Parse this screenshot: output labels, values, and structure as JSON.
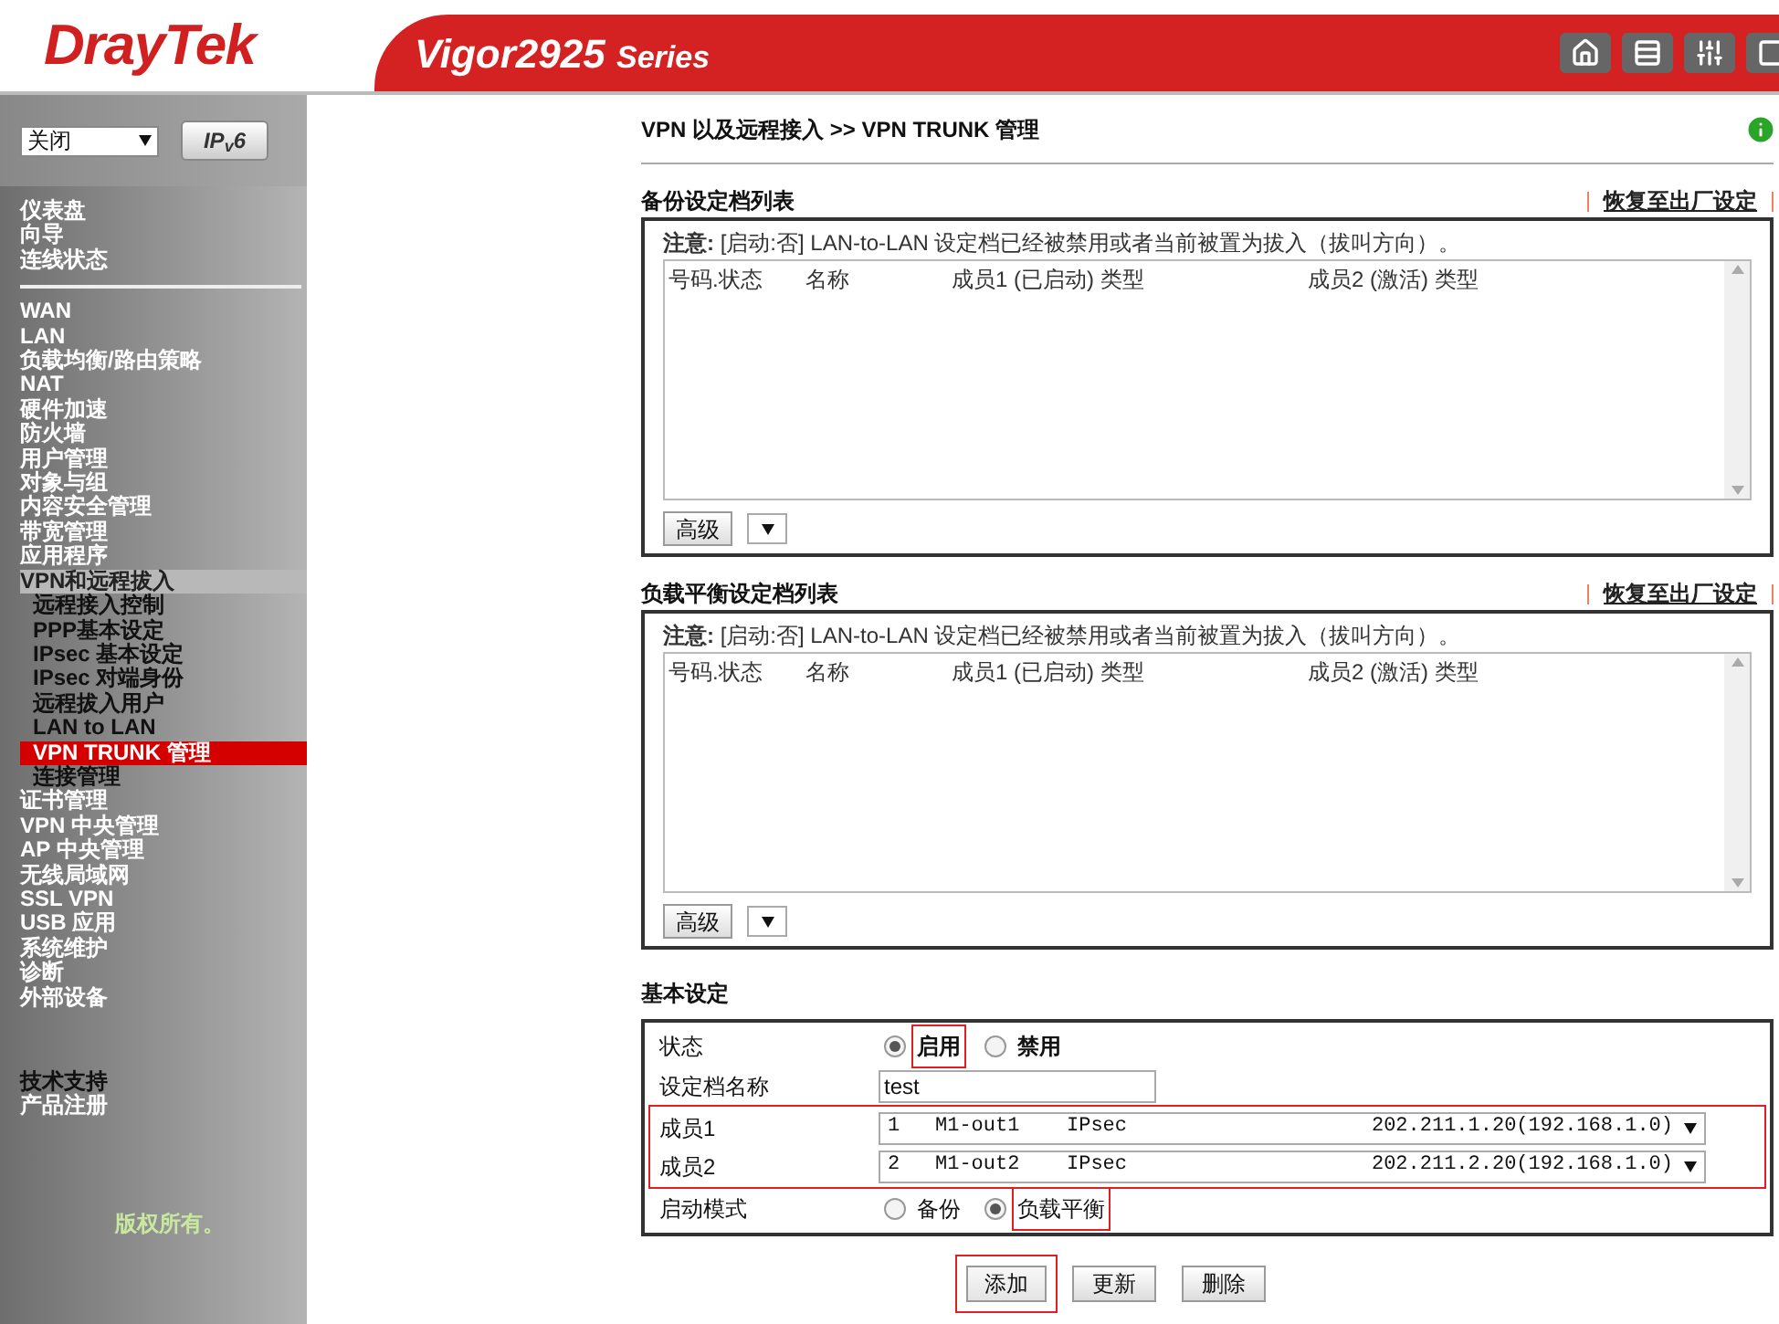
{
  "header": {
    "brand": "DrayTek",
    "model": "Vigor2925",
    "series": "Series"
  },
  "sidebar": {
    "mode_select": "关闭",
    "ipv6_button": "IP$_{v}$6",
    "groups": [
      [
        {
          "label": "仪表盘",
          "selected": false
        },
        {
          "label": "向导",
          "selected": false
        },
        {
          "label": "连线状态",
          "selected": false
        }
      ],
      [
        {
          "label": "WAN",
          "selected": false
        },
        {
          "label": "LAN",
          "selected": false
        },
        {
          "label": "负载均衡/路由策略",
          "selected": false
        },
        {
          "label": "NAT",
          "selected": false
        },
        {
          "label": "硬件加速",
          "selected": false
        },
        {
          "label": "防火墙",
          "selected": false
        },
        {
          "label": "用户管理",
          "selected": false
        },
        {
          "label": "对象与组",
          "selected": false
        },
        {
          "label": "内容安全管理",
          "selected": false
        },
        {
          "label": "带宽管理",
          "selected": false
        },
        {
          "label": "应用程序",
          "selected": false
        },
        {
          "label": "VPN和远程拔入",
          "selected": false,
          "expanded": true,
          "children": [
            {
              "label": "远程接入控制",
              "selected": false
            },
            {
              "label": "PPP基本设定",
              "selected": false
            },
            {
              "label": "IPsec 基本设定",
              "selected": false
            },
            {
              "label": "IPsec 对端身份",
              "selected": false
            },
            {
              "label": "远程拔入用户",
              "selected": false
            },
            {
              "label": "LAN to LAN",
              "selected": false
            },
            {
              "label": "VPN TRUNK 管理",
              "selected": true
            },
            {
              "label": "连接管理",
              "selected": false
            }
          ]
        },
        {
          "label": "证书管理",
          "selected": false
        },
        {
          "label": "VPN 中央管理",
          "selected": false
        },
        {
          "label": "AP 中央管理",
          "selected": false
        },
        {
          "label": "无线局域网",
          "selected": false
        },
        {
          "label": "SSL VPN",
          "selected": false
        },
        {
          "label": "USB 应用",
          "selected": false
        },
        {
          "label": "系统维护",
          "selected": false
        },
        {
          "label": "诊断",
          "selected": false
        },
        {
          "label": "外部设备",
          "selected": false
        }
      ],
      [
        {
          "label": "技术支持",
          "selected": false,
          "kind": "dark"
        },
        {
          "label": "产品注册",
          "selected": false,
          "kind": "light"
        }
      ]
    ],
    "copyright": "版权所有。"
  },
  "breadcrumb": "VPN 以及远程接入 >> VPN TRUNK 管理",
  "lists": [
    {
      "title": "备份设定档列表",
      "reset_link": "恢复至出厂设定",
      "note": "**注意:** [启动:否] LAN-to-LAN 设定档已经被禁用或者当前被置为拔入（拔叫方向）。",
      "columns": [
        "号码.状态",
        "名称",
        "成员1 (已启动) 类型",
        "成员2 (激活) 类型"
      ],
      "advanced_button": "高级"
    },
    {
      "title": "负载平衡设定档列表",
      "reset_link": "恢复至出厂设定",
      "note": "**注意:** [启动:否] LAN-to-LAN 设定档已经被禁用或者当前被置为拔入（拔叫方向）。",
      "columns": [
        "号码.状态",
        "名称",
        "成员1 (已启动) 类型",
        "成员2 (激活) 类型"
      ],
      "advanced_button": "高级"
    }
  ],
  "basic_settings": {
    "title": "基本设定",
    "status": {
      "label": "状态",
      "options": [
        {
          "label": "启用",
          "selected": true,
          "highlighted": true
        },
        {
          "label": "禁用",
          "selected": false,
          "highlighted": false
        }
      ]
    },
    "profile_name": {
      "label": "设定档名称",
      "value": "test"
    },
    "members_highlighted": true,
    "members": [
      {
        "label": "成员1",
        "number": "1",
        "profile": "M1-out1",
        "type": "IPsec",
        "address": "202.211.1.20(192.168.1.0)"
      },
      {
        "label": "成员2",
        "number": "2",
        "profile": "M1-out2",
        "type": "IPsec",
        "address": "202.211.2.20(192.168.1.0)"
      }
    ],
    "mode": {
      "label": "启动模式",
      "options": [
        {
          "label": "备份",
          "selected": false,
          "highlighted": false
        },
        {
          "label": "负载平衡",
          "selected": true,
          "highlighted": true
        }
      ]
    }
  },
  "buttons": [
    {
      "label": "添加",
      "highlighted": true
    },
    {
      "label": "更新",
      "highlighted": false
    },
    {
      "label": "删除",
      "highlighted": false
    }
  ]
}
